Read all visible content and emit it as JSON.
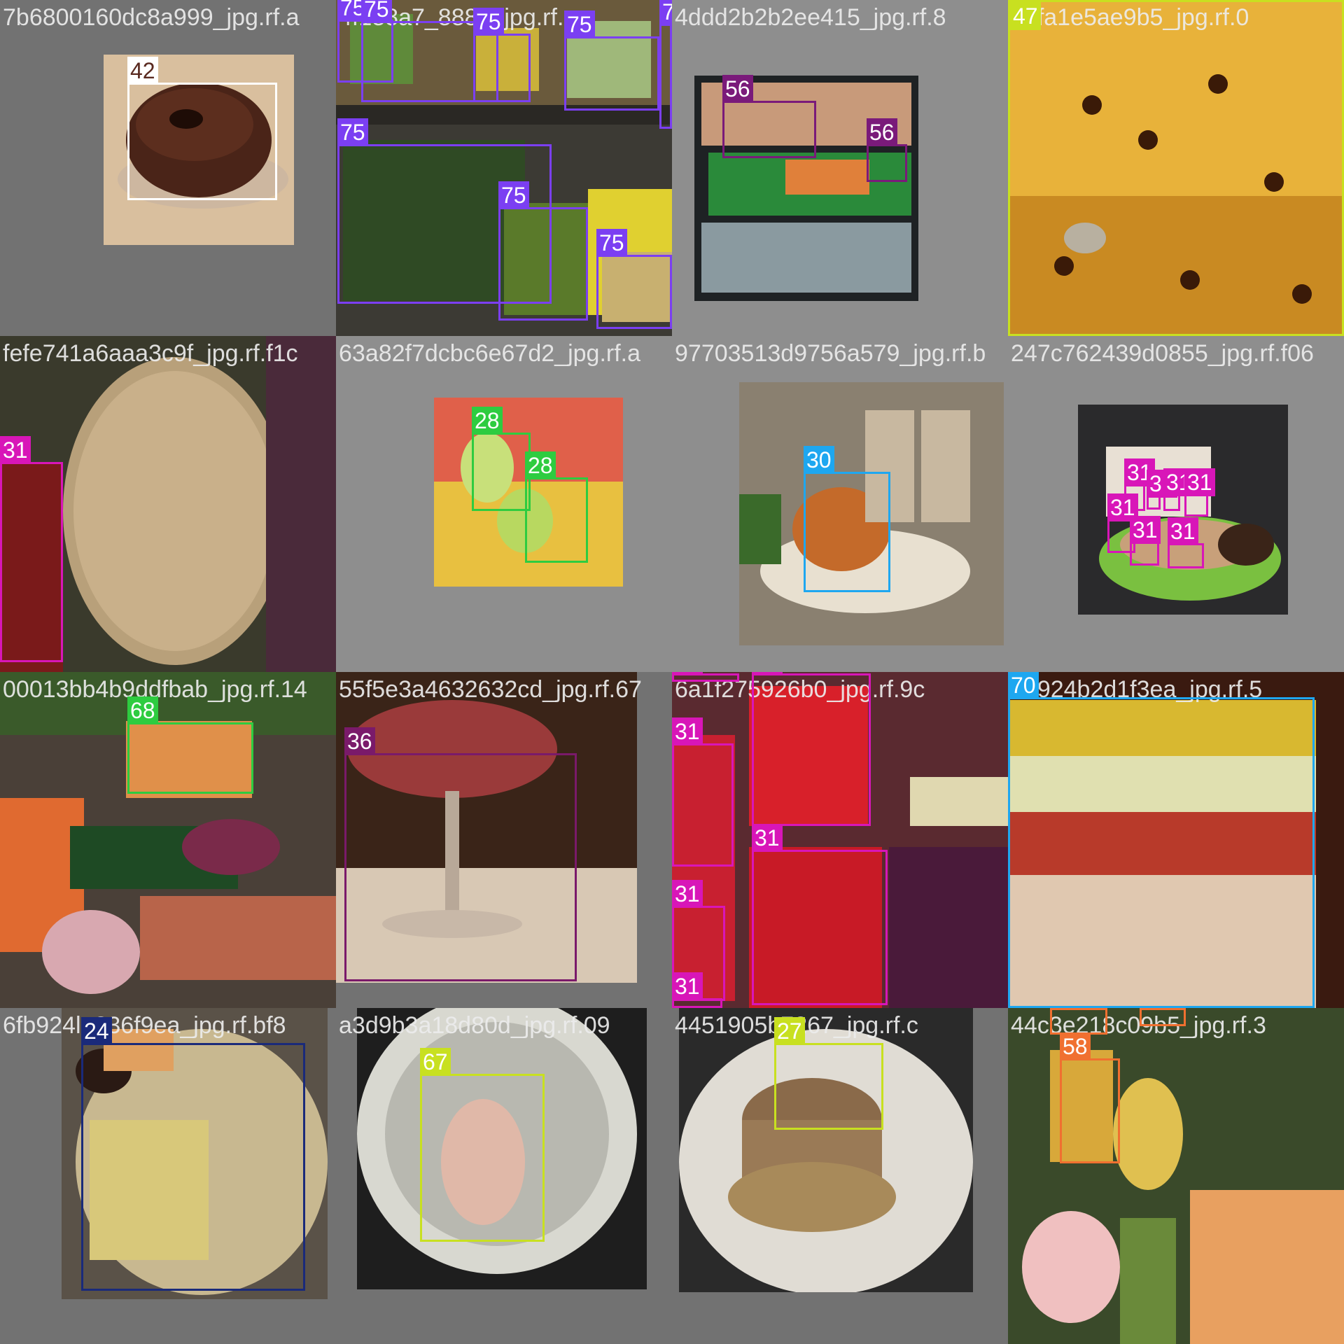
{
  "tiles": [
    {
      "filename": "7b6800160dc8a999_jpg.rf.a",
      "boxes": [
        {
          "label": "42",
          "color": "#ffffff",
          "text": "#5a2a20"
        }
      ]
    },
    {
      "filename": "4f188a7_8884_jpg.rf.",
      "boxes": [
        {
          "label": "75",
          "color": "#7b3ff2"
        },
        {
          "label": "75",
          "color": "#7b3ff2"
        },
        {
          "label": "75",
          "color": "#7b3ff2"
        },
        {
          "label": "75",
          "color": "#7b3ff2"
        },
        {
          "label": "75",
          "color": "#7b3ff2"
        },
        {
          "label": "75",
          "color": "#7b3ff2"
        },
        {
          "label": "75",
          "color": "#7b3ff2"
        },
        {
          "label": "75",
          "color": "#7b3ff2"
        }
      ]
    },
    {
      "filename": "4ddd2b2b2ee415_jpg.rf.8",
      "boxes": [
        {
          "label": "56",
          "color": "#7a1a7a"
        },
        {
          "label": "56",
          "color": "#7a1a7a"
        }
      ]
    },
    {
      "filename": "05fa1e5ae9b5_jpg.rf.0",
      "boxes": [
        {
          "label": "47",
          "color": "#c8e020"
        }
      ]
    },
    {
      "filename": "fefe741a6aaa3c9f_jpg.rf.f1c",
      "boxes": [
        {
          "label": "31",
          "color": "#d816b8"
        }
      ]
    },
    {
      "filename": "63a82f7dcbc6e67d2_jpg.rf.a",
      "boxes": [
        {
          "label": "28",
          "color": "#2ecc40"
        },
        {
          "label": "28",
          "color": "#2ecc40"
        }
      ]
    },
    {
      "filename": "97703513d9756a579_jpg.rf.b",
      "boxes": [
        {
          "label": "30",
          "color": "#1ea7f0"
        }
      ]
    },
    {
      "filename": "247c762439d0855_jpg.rf.f06",
      "boxes": [
        {
          "label": "31",
          "color": "#d816b8"
        },
        {
          "label": "31",
          "color": "#d816b8"
        },
        {
          "label": "31",
          "color": "#d816b8"
        },
        {
          "label": "31",
          "color": "#d816b8"
        },
        {
          "label": "31",
          "color": "#d816b8"
        },
        {
          "label": "31",
          "color": "#d816b8"
        },
        {
          "label": "31",
          "color": "#d816b8"
        }
      ]
    },
    {
      "filename": "00013bb4b9ddfbab_jpg.rf.14",
      "boxes": [
        {
          "label": "68",
          "color": "#2ecc40"
        }
      ]
    },
    {
      "filename": "55f5e3a4632632cd_jpg.rf.67",
      "boxes": [
        {
          "label": "36",
          "color": "#7a1a6a"
        }
      ]
    },
    {
      "filename": "6a1f275926b0_jpg.rf.9c",
      "boxes": [
        {
          "label": "31",
          "color": "#d816b8"
        },
        {
          "label": "31",
          "color": "#d816b8"
        },
        {
          "label": "31",
          "color": "#d816b8"
        },
        {
          "label": "31",
          "color": "#d816b8"
        },
        {
          "label": "31",
          "color": "#d816b8"
        },
        {
          "label": "31",
          "color": "#d816b8"
        }
      ]
    },
    {
      "filename": "a2924b2d1f3ea_jpg.rf.5",
      "boxes": [
        {
          "label": "70",
          "color": "#1ea7f0"
        }
      ]
    },
    {
      "filename": "6fb924le236f9ea_jpg.rf.bf8",
      "boxes": [
        {
          "label": "24",
          "color": "#1a2a7a"
        }
      ]
    },
    {
      "filename": "a3d9b3a18d80d_jpg.rf.09",
      "boxes": [
        {
          "label": "67",
          "color": "#c8e020"
        }
      ]
    },
    {
      "filename": "4451905b7267_jpg.rf.c",
      "boxes": [
        {
          "label": "27",
          "color": "#c8e020"
        }
      ]
    },
    {
      "filename": "44c3e218c09b5_jpg.rf.3",
      "boxes": [
        {
          "label": "58",
          "color": "#f07030"
        },
        {
          "label": "58",
          "color": "#f07030"
        },
        {
          "label": "58",
          "color": "#f07030"
        }
      ]
    }
  ]
}
